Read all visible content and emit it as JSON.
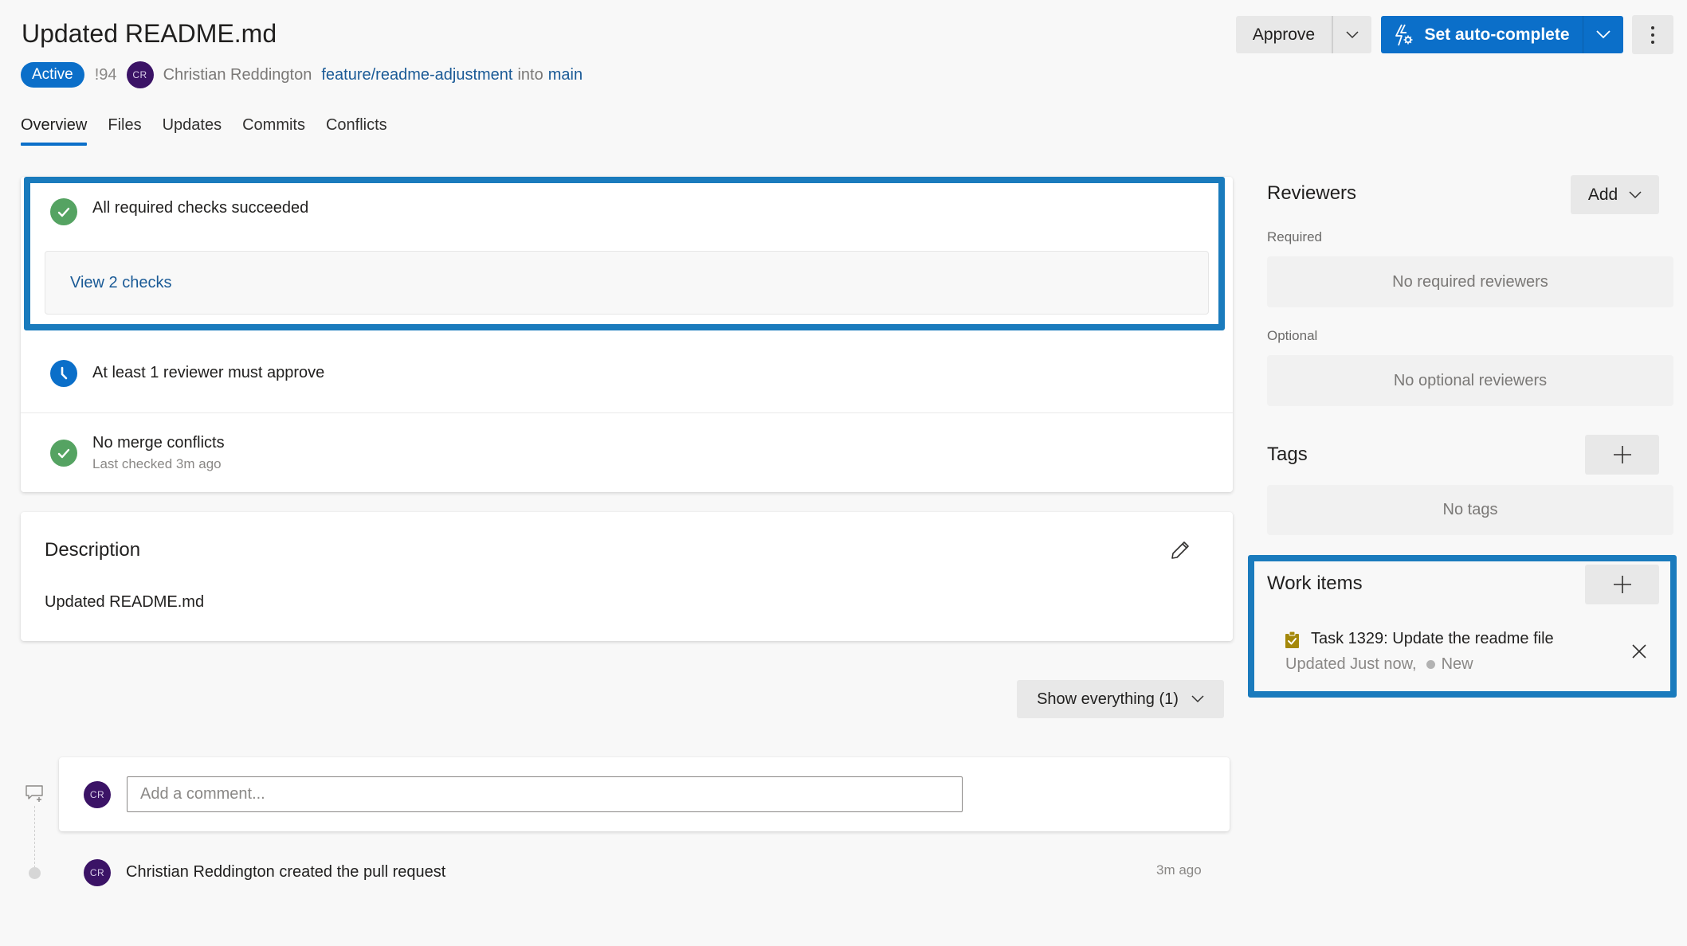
{
  "header": {
    "title": "Updated README.md",
    "status_badge": "Active",
    "pr_id": "!94",
    "author_initials": "CR",
    "author_name": "Christian Reddington",
    "source_branch": "feature/readme-adjustment",
    "into_text": "into",
    "target_branch": "main"
  },
  "tabs": [
    {
      "label": "Overview",
      "active": true
    },
    {
      "label": "Files",
      "active": false
    },
    {
      "label": "Updates",
      "active": false
    },
    {
      "label": "Commits",
      "active": false
    },
    {
      "label": "Conflicts",
      "active": false
    }
  ],
  "toolbar": {
    "approve_label": "Approve",
    "auto_complete_label": "Set auto-complete",
    "more_icon": "more-vertical-icon"
  },
  "checks": {
    "all_checks": {
      "title": "All required checks succeeded",
      "icon": "check-circle-icon",
      "status": "success"
    },
    "view_checks_link": "View 2 checks",
    "reviewer_policy": {
      "title": "At least 1 reviewer must approve",
      "icon": "clock-icon",
      "status": "pending"
    },
    "merge": {
      "title": "No merge conflicts",
      "subtitle": "Last checked 3m ago",
      "icon": "check-circle-icon",
      "status": "success"
    }
  },
  "description": {
    "title": "Description",
    "body": "Updated README.md",
    "edit_icon": "pencil-icon"
  },
  "activity": {
    "filter_label": "Show everything (1)",
    "comment_placeholder": "Add a comment...",
    "comment_avatar_initials": "CR",
    "events": [
      {
        "avatar_initials": "CR",
        "text": "Christian Reddington created the pull request",
        "time": "3m ago"
      }
    ]
  },
  "sidebar": {
    "reviewers": {
      "title": "Reviewers",
      "add_label": "Add",
      "required_label": "Required",
      "required_empty": "No required reviewers",
      "optional_label": "Optional",
      "optional_empty": "No optional reviewers"
    },
    "tags": {
      "title": "Tags",
      "empty": "No tags"
    },
    "work_items": {
      "title": "Work items",
      "items": [
        {
          "title": "Task 1329: Update the readme file",
          "updated": "Updated Just now,",
          "state": "New",
          "type_icon": "task-clipboard-icon"
        }
      ]
    }
  },
  "colors": {
    "accent": "#0b6fc9",
    "highlight_border": "#1a7bbd",
    "success": "#55a362",
    "avatar": "#3b1366",
    "link": "#1a5a96",
    "task_icon": "#a4880a"
  }
}
